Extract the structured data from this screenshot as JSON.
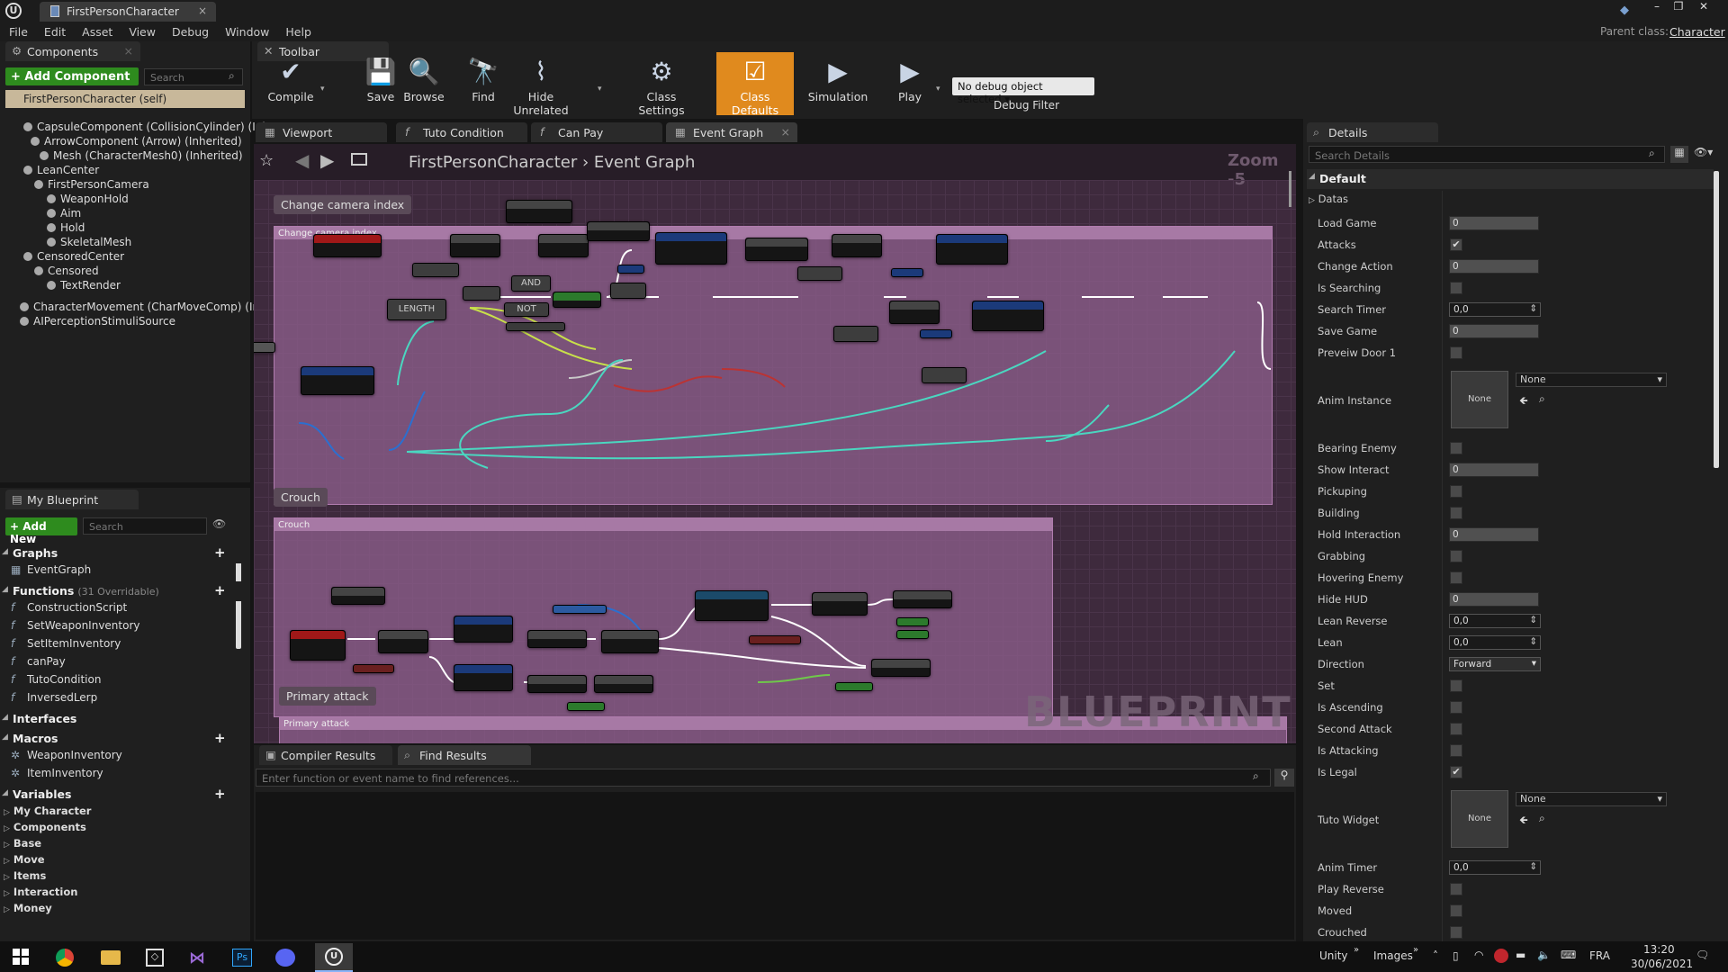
{
  "window": {
    "tab_title": "FirstPersonCharacter",
    "parent_class_label": "Parent class:",
    "parent_class_value": "Character"
  },
  "menu": [
    "File",
    "Edit",
    "Asset",
    "View",
    "Debug",
    "Window",
    "Help"
  ],
  "components_panel": {
    "tab_label": "Components",
    "add_button": "+ Add Component",
    "search_placeholder": "Search",
    "self_item": "FirstPersonCharacter (self)",
    "tree": [
      {
        "label": "CapsuleComponent (CollisionCylinder) (Inh"
      },
      {
        "label": "ArrowComponent (Arrow) (Inherited)"
      },
      {
        "label": "Mesh (CharacterMesh0) (Inherited)"
      },
      {
        "label": "LeanCenter"
      },
      {
        "label": "FirstPersonCamera"
      },
      {
        "label": "WeaponHold"
      },
      {
        "label": "Aim"
      },
      {
        "label": "Hold"
      },
      {
        "label": "SkeletalMesh"
      },
      {
        "label": "CensoredCenter"
      },
      {
        "label": "Censored"
      },
      {
        "label": "TextRender"
      },
      {
        "label": "CharacterMovement (CharMoveComp) (Inh"
      },
      {
        "label": "AIPerceptionStimuliSource"
      }
    ]
  },
  "toolbar": {
    "tab_label": "Toolbar",
    "buttons": [
      "Compile",
      "Save",
      "Browse",
      "Find",
      "Hide Unrelated",
      "Class Settings",
      "Class Defaults",
      "Simulation",
      "Play"
    ],
    "debug_select": "No debug object selected",
    "debug_filter_label": "Debug Filter"
  },
  "editor_tabs": [
    "Viewport",
    "Tuto Condition",
    "Can Pay",
    "Event Graph"
  ],
  "graph": {
    "breadcrumb_class": "FirstPersonCharacter",
    "breadcrumb_graph": "Event Graph",
    "zoom": "Zoom -5",
    "watermark": "BLUEPRINT",
    "comments": [
      {
        "header": "Change camera index",
        "inner": "Change camera index"
      },
      {
        "header": "Crouch",
        "inner": "Crouch"
      },
      {
        "header": "Primary attack",
        "inner": "Primary attack"
      }
    ],
    "node_labels": {
      "length": "LENGTH",
      "and": "AND",
      "not": "NOT"
    }
  },
  "my_blueprint": {
    "tab_label": "My Blueprint",
    "add_button": "+ Add New",
    "search_placeholder": "Search",
    "graphs_label": "Graphs",
    "graphs": [
      "EventGraph"
    ],
    "functions_label": "Functions",
    "functions_count": "(31 Overridable)",
    "functions": [
      "ConstructionScript",
      "SetWeaponInventory",
      "SetItemInventory",
      "canPay",
      "TutoCondition",
      "InversedLerp"
    ],
    "interfaces_label": "Interfaces",
    "macros_label": "Macros",
    "macros": [
      "WeaponInventory",
      "ItemInventory"
    ],
    "variables_label": "Variables",
    "variable_categories": [
      "My Character",
      "Components",
      "Base",
      "Move",
      "Items",
      "Interaction",
      "Money"
    ]
  },
  "bottom_panel": {
    "tabs": [
      "Compiler Results",
      "Find Results"
    ],
    "find_placeholder": "Enter function or event name to find references..."
  },
  "details": {
    "tab_label": "Details",
    "search_placeholder": "Search Details",
    "section": "Default",
    "datas_label": "Datas",
    "rows": [
      {
        "label": "Load Game",
        "type": "num",
        "value": "0"
      },
      {
        "label": "Attacks",
        "type": "check",
        "checked": true
      },
      {
        "label": "Change Action",
        "type": "num",
        "value": "0"
      },
      {
        "label": "Is Searching",
        "type": "check",
        "checked": false
      },
      {
        "label": "Search Timer",
        "type": "spin",
        "value": "0,0"
      },
      {
        "label": "Save Game",
        "type": "num",
        "value": "0"
      },
      {
        "label": "Preveiw Door 1",
        "type": "check",
        "checked": false
      }
    ],
    "anim_instance": {
      "label": "Anim Instance",
      "thumb": "None",
      "select": "None"
    },
    "rows2": [
      {
        "label": "Bearing Enemy",
        "type": "check",
        "checked": false
      },
      {
        "label": "Show Interact",
        "type": "num",
        "value": "0"
      },
      {
        "label": "Pickuping",
        "type": "check",
        "checked": false
      },
      {
        "label": "Building",
        "type": "check",
        "checked": false
      },
      {
        "label": "Hold Interaction",
        "type": "num",
        "value": "0"
      },
      {
        "label": "Grabbing",
        "type": "check",
        "checked": false
      },
      {
        "label": "Hovering Enemy",
        "type": "check",
        "checked": false
      },
      {
        "label": "Hide HUD",
        "type": "num",
        "value": "0"
      },
      {
        "label": "Lean Reverse",
        "type": "spin",
        "value": "0,0"
      },
      {
        "label": "Lean",
        "type": "spin",
        "value": "0,0"
      },
      {
        "label": "Direction",
        "type": "select",
        "value": "Forward"
      },
      {
        "label": "Set",
        "type": "check",
        "checked": false
      },
      {
        "label": "Is Ascending",
        "type": "check",
        "checked": false
      },
      {
        "label": "Second Attack",
        "type": "check",
        "checked": false
      },
      {
        "label": "Is Attacking",
        "type": "check",
        "checked": false
      },
      {
        "label": "Is Legal",
        "type": "check",
        "checked": true
      }
    ],
    "tuto_widget": {
      "label": "Tuto Widget",
      "thumb": "None",
      "select": "None"
    },
    "rows3": [
      {
        "label": "Anim Timer",
        "type": "spin",
        "value": "0,0"
      },
      {
        "label": "Play Reverse",
        "type": "check",
        "checked": false
      },
      {
        "label": "Moved",
        "type": "check",
        "checked": false
      },
      {
        "label": "Crouched",
        "type": "check",
        "checked": false
      }
    ]
  },
  "taskbar": {
    "folders": [
      "Unity",
      "Images"
    ],
    "lang": "FRA",
    "time": "13:20",
    "date": "30/06/2021"
  }
}
